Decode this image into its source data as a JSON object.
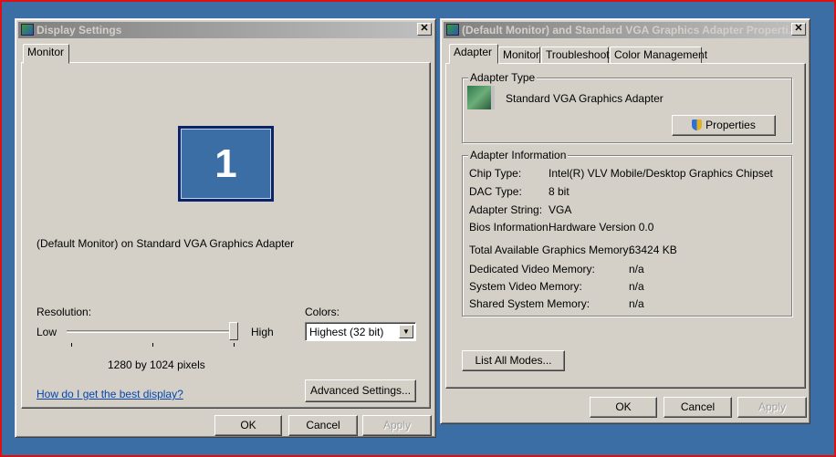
{
  "display_settings": {
    "title": "Display Settings",
    "tab": "Monitor",
    "monitor_number": "1",
    "monitor_description": "(Default Monitor) on Standard VGA Graphics Adapter",
    "resolution_label": "Resolution:",
    "low_label": "Low",
    "high_label": "High",
    "resolution_slider_fraction": 1.0,
    "resolution_value": "1280 by 1024 pixels",
    "colors_label": "Colors:",
    "colors_selected": "Highest (32 bit)",
    "help_link": "How do I get the best display?",
    "advanced_button": "Advanced Settings...",
    "ok": "OK",
    "cancel": "Cancel",
    "apply": "Apply"
  },
  "adapter_properties": {
    "title": "(Default Monitor) and Standard VGA Graphics Adapter Properti...",
    "tabs": [
      "Adapter",
      "Monitor",
      "Troubleshoot",
      "Color Management"
    ],
    "adapter_type_label": "Adapter Type",
    "adapter_name": "Standard VGA Graphics Adapter",
    "properties_button": "Properties",
    "adapter_info_label": "Adapter Information",
    "info": [
      {
        "label": "Chip Type:",
        "value": "Intel(R) VLV Mobile/Desktop Graphics Chipset"
      },
      {
        "label": "DAC Type:",
        "value": "8 bit"
      },
      {
        "label": "Adapter String:",
        "value": "VGA"
      },
      {
        "label": "Bios Information:",
        "value": "Hardware Version 0.0"
      }
    ],
    "memory": [
      {
        "label": "Total Available Graphics Memory:",
        "value": "63424 KB"
      },
      {
        "label": "Dedicated Video Memory:",
        "value": "n/a"
      },
      {
        "label": "System Video Memory:",
        "value": "n/a"
      },
      {
        "label": "Shared System Memory:",
        "value": "n/a"
      }
    ],
    "list_modes_button": "List All Modes...",
    "ok": "OK",
    "cancel": "Cancel",
    "apply": "Apply"
  }
}
